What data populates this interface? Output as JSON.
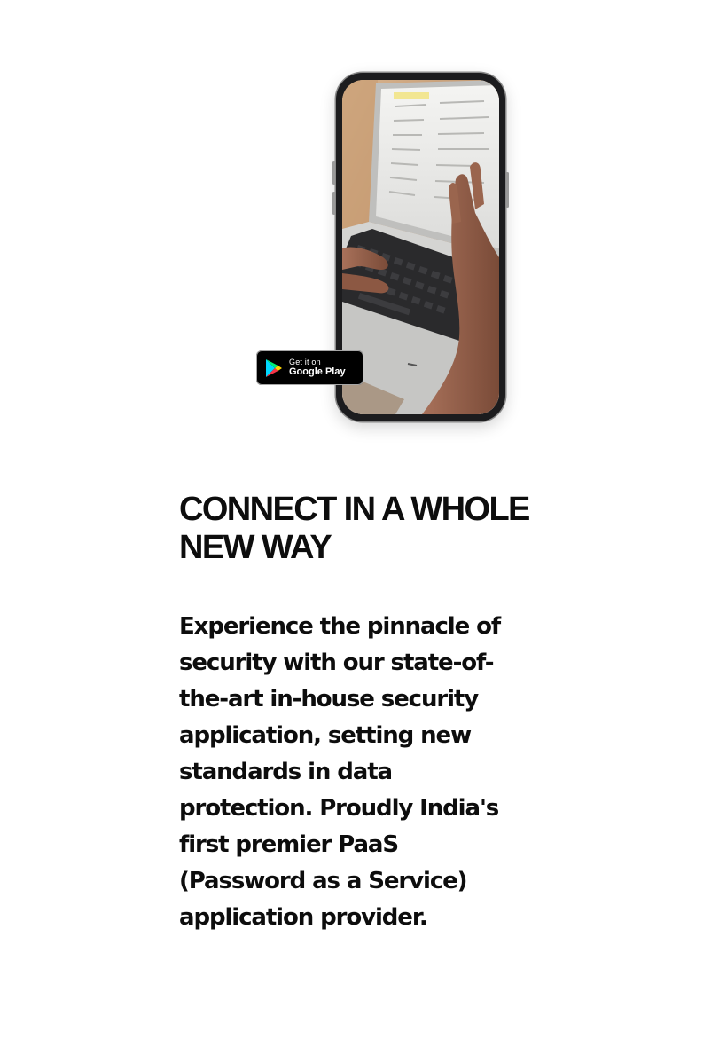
{
  "hero": {
    "store_badge": {
      "small_text": "Get it on",
      "store_name": "Google Play"
    }
  },
  "content": {
    "headline": "CONNECT IN A WHOLE NEW WAY",
    "description": "Experience the pinnacle of security with our state-of-the-art in-house security application, setting new standards in data protection. Proudly India's first premier PaaS (Password as a Service) application provider."
  },
  "icons": {
    "store": "google-play-icon"
  },
  "colors": {
    "text": "#0d0d0d",
    "badge_background": "#000000",
    "background": "#ffffff"
  }
}
